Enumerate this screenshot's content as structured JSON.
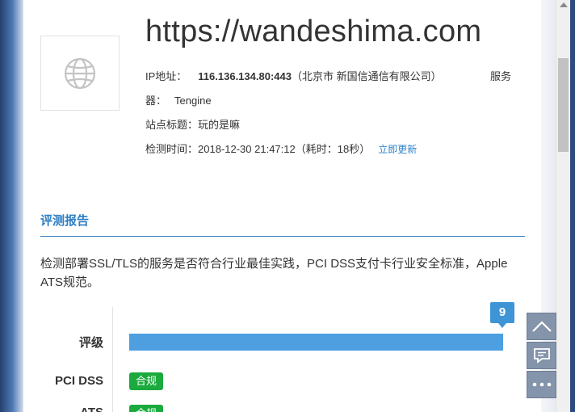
{
  "site": {
    "url_title": "https://wandeshima.com",
    "ip_label": "IP地址：",
    "ip_value": "116.136.134.80:443",
    "ip_location": "（北京市 新国信通信有限公司）",
    "server_label_part1": "服务",
    "server_label_part2": "器：",
    "server_value": "Tengine",
    "page_title_label": "站点标题：",
    "page_title_value": "玩的是嘛",
    "check_time_label": "检测时间：",
    "check_time_value": "2018-12-30 21:47:12",
    "duration": "（耗时：18秒）",
    "refresh_link": "立即更新",
    "icon": "globe-icon"
  },
  "report": {
    "section_title": "评测报告",
    "description": "检测部署SSL/TLS的服务是否符合行业最佳实践，PCI DSS支付卡行业安全标准，Apple ATS规范。",
    "rating_label": "评级",
    "rating_score": "9",
    "rating_fill_fraction": 1.0,
    "rating_color": "#4d9fe0",
    "pci_label": "PCI DSS",
    "pci_status": "合规",
    "ats_label": "ATS",
    "ats_status": "合规",
    "pass_color": "#1aaa3d"
  },
  "floating_tools": {
    "icons": [
      "chevron-up-icon",
      "comment-icon",
      "more-icon"
    ]
  }
}
